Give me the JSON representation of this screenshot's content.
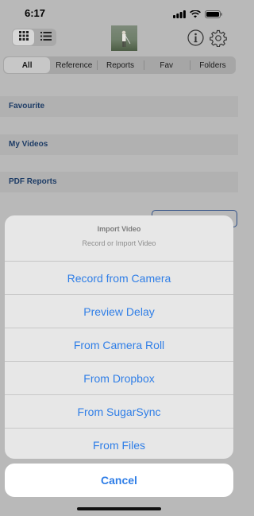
{
  "status_bar": {
    "time": "6:17"
  },
  "filter_tabs": [
    {
      "label": "All",
      "selected": true
    },
    {
      "label": "Reference",
      "selected": false
    },
    {
      "label": "Reports",
      "selected": false
    },
    {
      "label": "Fav",
      "selected": false
    },
    {
      "label": "Folders",
      "selected": false
    }
  ],
  "sections": [
    {
      "label": "Favourite"
    },
    {
      "label": "My Videos"
    },
    {
      "label": "PDF Reports"
    }
  ],
  "action_sheet": {
    "title": "Import Video",
    "message": "Record or Import Video",
    "actions": [
      "Record from Camera",
      "Preview Delay",
      "From Camera Roll",
      "From Dropbox",
      "From SugarSync",
      "From Files"
    ],
    "cancel_label": "Cancel"
  },
  "colors": {
    "accent": "#2f7ee7",
    "section_label": "#1d3c66"
  }
}
